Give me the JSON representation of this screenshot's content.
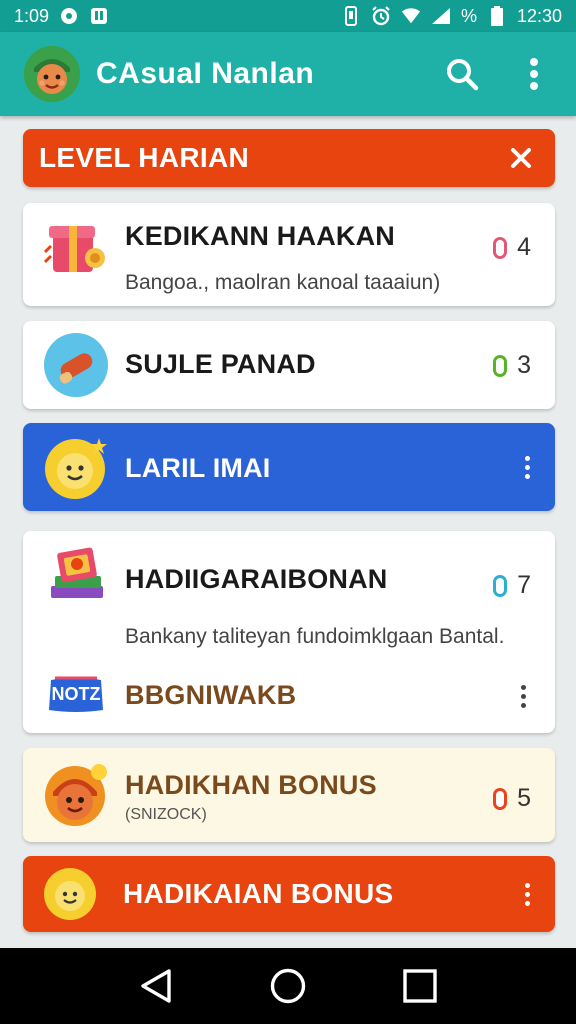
{
  "status_bar": {
    "time": "1:09",
    "clock": "12:30",
    "percent": "%"
  },
  "app_bar": {
    "title": "CAsuaI Nanlan"
  },
  "banner_top": {
    "title": "LEVEL HARIAN"
  },
  "items": [
    {
      "title": "KEDIKANN HAAKAN",
      "subtitle": "Bangoa., maolran kanoal taaaiun)",
      "count": "4",
      "pill_color": "#e05a78"
    },
    {
      "title": "SUJLE PANAD",
      "count": "3",
      "pill_color": "#58b22a"
    }
  ],
  "blue_card": {
    "title": "LARIL IMAI",
    "color": "#2a63d8"
  },
  "group_card": {
    "title": "HADIIGARAIBONAN",
    "subtitle": "Bankany taliteyan fundoimklgaan Bantal.",
    "count": "7",
    "pill_color": "#2bb0d3",
    "sub_item": {
      "tag": "NOTZ",
      "title": "BBGNIWAKB"
    }
  },
  "bonus_card": {
    "title": "HADIKHAN BONUS",
    "subtitle": "(SNIZOCK)",
    "count": "5",
    "pill_color": "#e8441f"
  },
  "banner_bottom": {
    "title": "HADIKAIAN BONUS"
  },
  "colors": {
    "teal": "#1fb1a7",
    "teal_dark": "#139e94",
    "orange": "#e8440f",
    "blue": "#2a63d8",
    "cream": "#fdf8e4",
    "brown": "#7a4a1c"
  }
}
